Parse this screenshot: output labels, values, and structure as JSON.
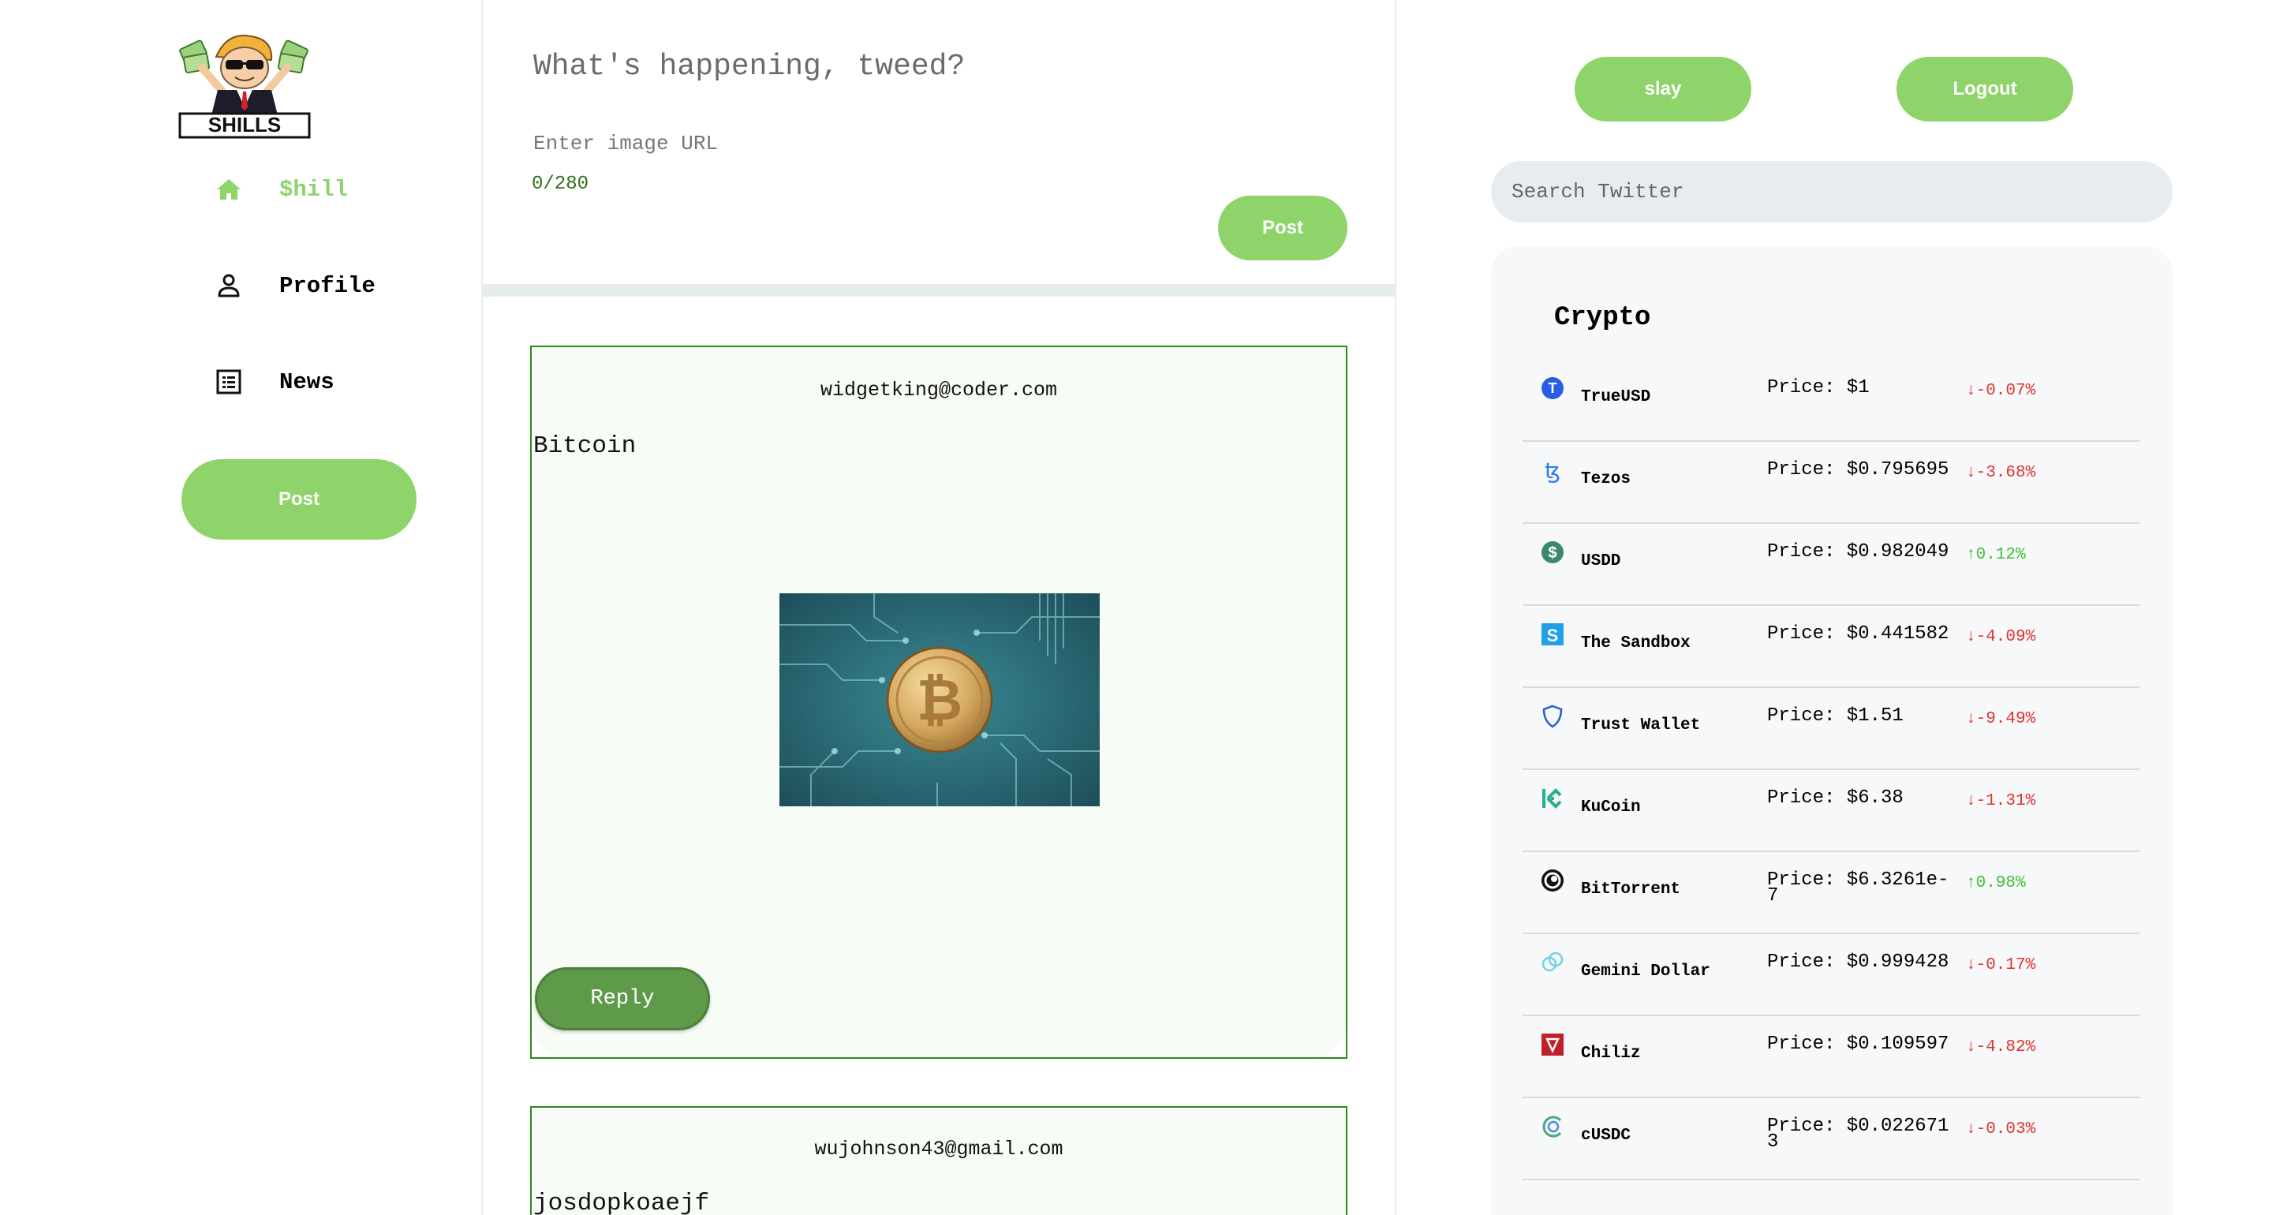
{
  "sidebar": {
    "logo_text": "SHILLS",
    "nav": [
      {
        "label": "$hill",
        "icon": "home-icon",
        "active": true
      },
      {
        "label": "Profile",
        "icon": "person-icon",
        "active": false
      },
      {
        "label": "News",
        "icon": "news-icon",
        "active": false
      }
    ],
    "post_label": "Post"
  },
  "composer": {
    "placeholder": "What's happening, tweed?",
    "url_placeholder": "Enter image URL",
    "counter": "0/280",
    "post_label": "Post"
  },
  "feed": {
    "tweets": [
      {
        "author": "widgetking@coder.com",
        "body": "Bitcoin",
        "image": "bitcoin-circuit-image",
        "reply_label": "Reply"
      },
      {
        "author": "wujohnson43@gmail.com",
        "body": "josdopkoaejf"
      }
    ]
  },
  "header": {
    "user_button": "slay",
    "logout_label": "Logout"
  },
  "search": {
    "placeholder": "Search Twitter"
  },
  "crypto": {
    "title": "Crypto",
    "rows": [
      {
        "name": "TrueUSD",
        "price": "Price: $1",
        "change": "↓-0.07%",
        "direction": "down",
        "icon": "trueusd-icon"
      },
      {
        "name": "Tezos",
        "price": "Price: $0.795695",
        "change": "↓-3.68%",
        "direction": "down",
        "icon": "tezos-icon"
      },
      {
        "name": "USDD",
        "price": "Price: $0.982049",
        "change": "↑0.12%",
        "direction": "up",
        "icon": "usdd-icon"
      },
      {
        "name": "The Sandbox",
        "price": "Price: $0.441582",
        "change": "↓-4.09%",
        "direction": "down",
        "icon": "sandbox-icon"
      },
      {
        "name": "Trust Wallet",
        "price": "Price: $1.51",
        "change": "↓-9.49%",
        "direction": "down",
        "icon": "trust-wallet-icon"
      },
      {
        "name": "KuCoin",
        "price": "Price: $6.38",
        "change": "↓-1.31%",
        "direction": "down",
        "icon": "kucoin-icon"
      },
      {
        "name": "BitTorrent",
        "price": "Price: $6.3261e-7",
        "change": "↑0.98%",
        "direction": "up",
        "icon": "bittorrent-icon"
      },
      {
        "name": "Gemini Dollar",
        "price": "Price: $0.999428",
        "change": "↓-0.17%",
        "direction": "down",
        "icon": "gemini-dollar-icon"
      },
      {
        "name": "Chiliz",
        "price": "Price: $0.109597",
        "change": "↓-4.82%",
        "direction": "down",
        "icon": "chiliz-icon"
      },
      {
        "name": "cUSDC",
        "price": "Price: $0.0226713",
        "change": "↓-0.03%",
        "direction": "down",
        "icon": "cusdc-icon"
      }
    ]
  },
  "colors": {
    "accent": "#8fd46a",
    "tweet_border": "#2f8a22",
    "reply": "#5f9a4a",
    "down": "#e0342e",
    "up": "#3fc03a"
  }
}
